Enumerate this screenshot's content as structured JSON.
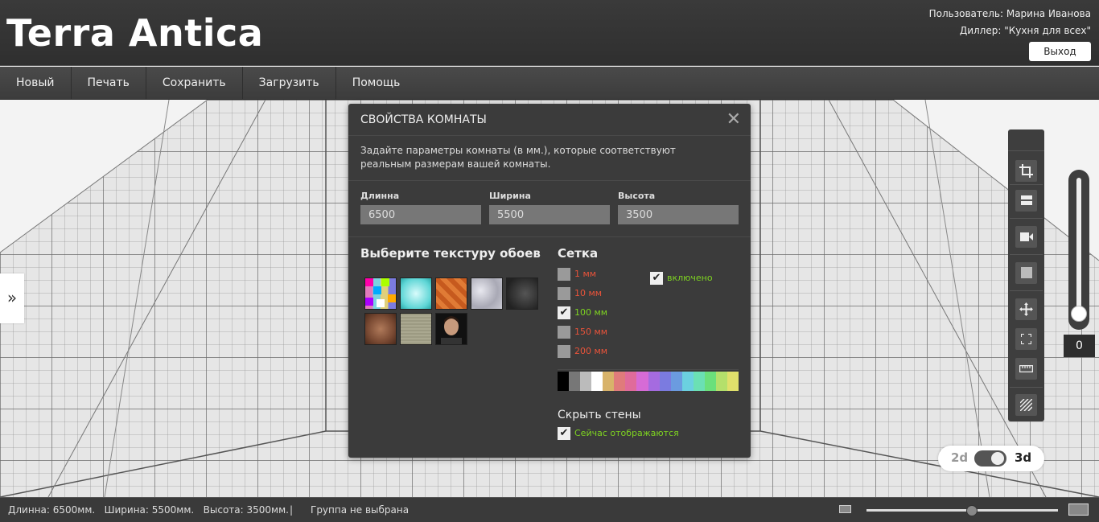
{
  "header": {
    "logo": "Terra Antica",
    "user_line": "Пользователь: Марина Иванова",
    "dealer_line": "Диллер: \"Кухня для всех\"",
    "logout_label": "Выход"
  },
  "menu": {
    "items": [
      {
        "label": "Новый"
      },
      {
        "label": "Печать"
      },
      {
        "label": "Сохранить"
      },
      {
        "label": "Загрузить"
      },
      {
        "label": "Помощь"
      }
    ]
  },
  "viewport": {
    "side_toggle_icon": "»",
    "zoom_value": "0",
    "zoom_level": 0,
    "view_toggle": {
      "label_2d": "2d",
      "label_3d": "3d",
      "active": "3d"
    }
  },
  "toolbar": {
    "icons": [
      "crop-icon",
      "layer-icon",
      "camera-icon",
      "square-icon",
      "move-icon",
      "fullscreen-icon",
      "ruler-icon",
      "hatch-icon"
    ]
  },
  "modal": {
    "title": "СВОЙСТВА КОМНАТЫ",
    "close_icon": "✕",
    "description": "Задайте параметры комнаты (в мм.), которые соответствуют реальным размерам вашей комнаты.",
    "fields": {
      "length": {
        "label": "Длинна",
        "value": "6500"
      },
      "width": {
        "label": "Ширина",
        "value": "5500"
      },
      "height": {
        "label": "Высота",
        "value": "3500"
      }
    },
    "texture_title": "Выберите текстуру обоев",
    "grid": {
      "title": "Сетка",
      "options": [
        {
          "label": "1 мм",
          "checked": false,
          "color": "#e8533a"
        },
        {
          "label": "10 мм",
          "checked": false,
          "color": "#e8533a"
        },
        {
          "label": "100 мм",
          "checked": true,
          "color": "#7ed321"
        },
        {
          "label": "150 мм",
          "checked": false,
          "color": "#e8533a"
        },
        {
          "label": "200 мм",
          "checked": false,
          "color": "#e8533a"
        }
      ],
      "enabled_label": "включено",
      "enabled_checked": true,
      "enabled_color": "#7ed321",
      "colors": [
        "#000000",
        "#777777",
        "#bbbbbb",
        "#ffffff",
        "#d8b36a",
        "#e07b7b",
        "#e06b9b",
        "#d66bd6",
        "#a56be0",
        "#7b7be0",
        "#6b9be0",
        "#6bd0e0",
        "#6be0b4",
        "#6be07b",
        "#b4e06b",
        "#e0e06b"
      ]
    },
    "hide_walls": {
      "title": "Скрыть стены",
      "label": "Сейчас отображаются",
      "checked": true,
      "color": "#7ed321"
    }
  },
  "statusbar": {
    "dims": "Длинна: 6500мм.   Ширина: 5500мм.   Высота: 3500мм.",
    "separator": "|",
    "group": "Группа не выбрана",
    "zoom_fraction": 0.55
  }
}
